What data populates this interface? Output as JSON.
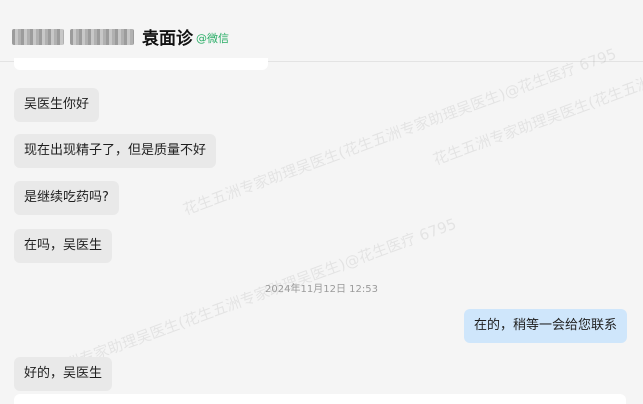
{
  "header": {
    "name": "袁面诊",
    "tag": "@微信"
  },
  "messages": [
    {
      "text": "吴医生你好"
    },
    {
      "text": "现在出现精子了，但是质量不好"
    },
    {
      "text": "是继续吃药吗?"
    },
    {
      "text": "在吗，吴医生"
    }
  ],
  "timestamp": "2024年11月12日 12:53",
  "reply": {
    "text": "在的，稍等一会给您联系"
  },
  "last_message": {
    "text": "好的，吴医生"
  },
  "watermark": {
    "text": "花生五洲专家助理吴医生(花生五洲专家助理吴医生)@花生医疗 6795"
  }
}
